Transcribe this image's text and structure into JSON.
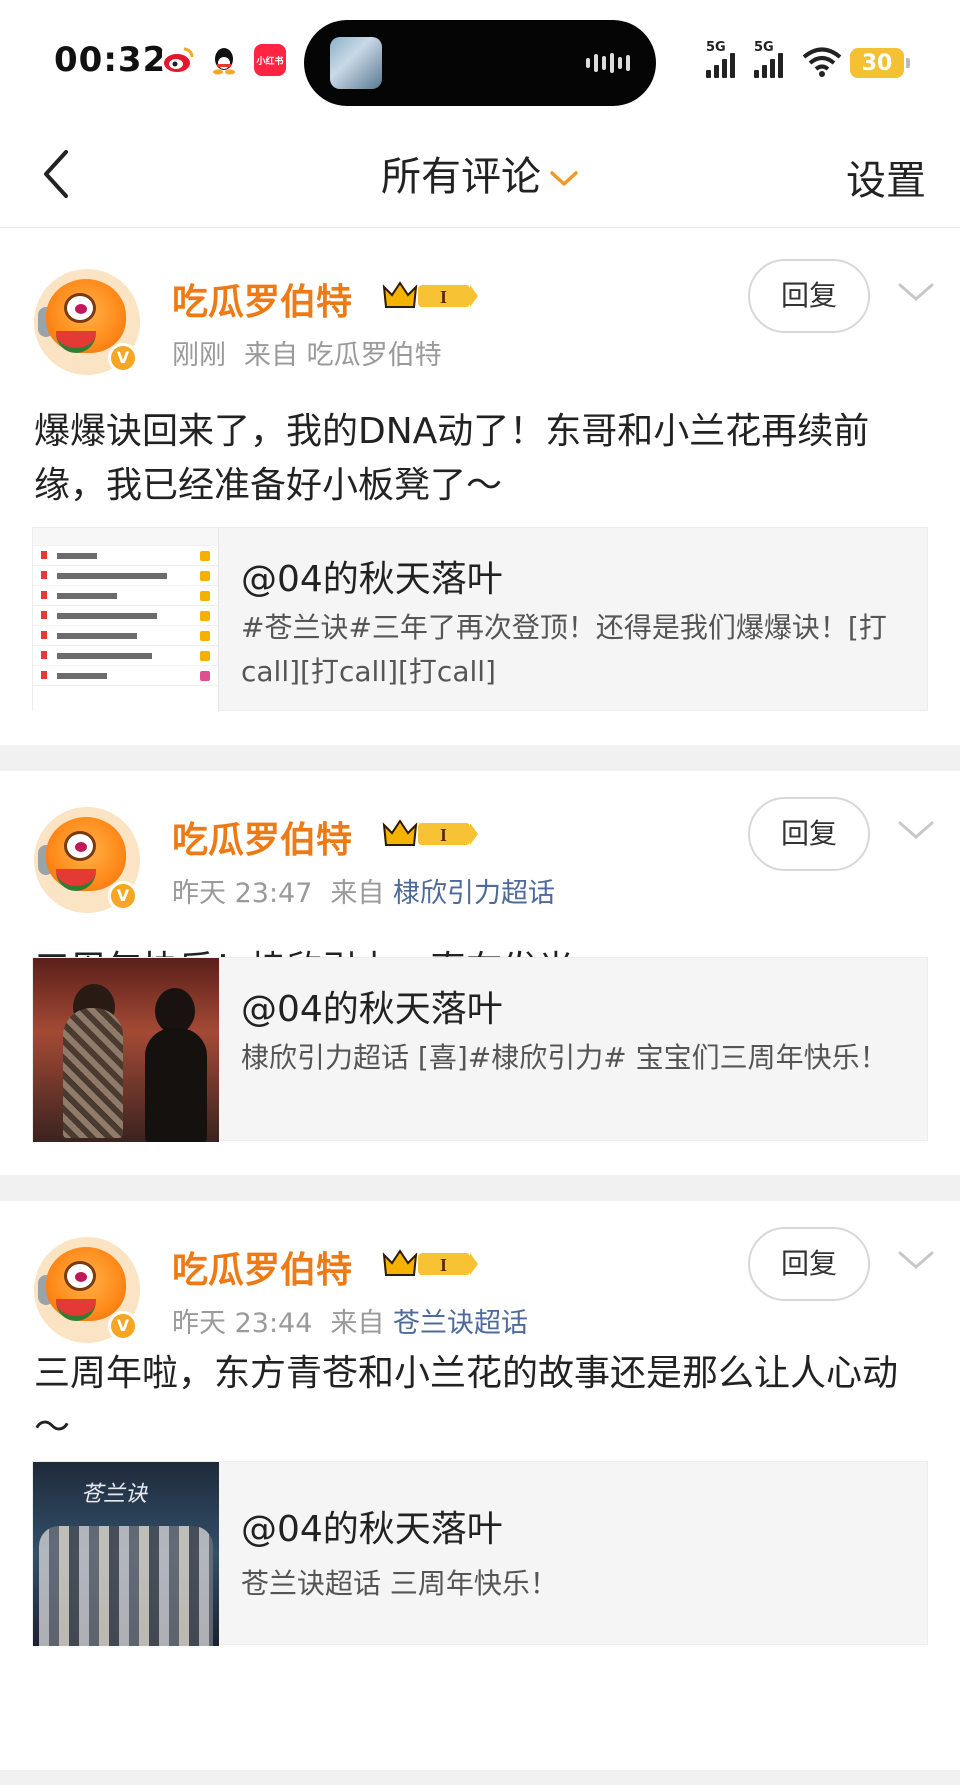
{
  "status_bar": {
    "time": "00:32",
    "apps": [
      "weibo-icon",
      "qq-icon",
      "xiaohongshu-icon"
    ],
    "xhs_label": "小红书",
    "signal_1": "5G",
    "signal_2": "5G",
    "battery": "30",
    "battery_color": "#f3c132"
  },
  "nav": {
    "title": "所有评论",
    "settings_label": "设置",
    "accent": "#ee7a16"
  },
  "comments": [
    {
      "username": "吃瓜罗伯特",
      "time": "刚刚",
      "source_prefix": "来自",
      "source": "吃瓜罗伯特",
      "reply_label": "回复",
      "text": "爆爆诀回来了，我的DNA动了！东哥和小兰花再续前缘，我已经准备好小板凳了～",
      "quote": {
        "title": "@04的秋天落叶",
        "text": "#苍兰诀#三年了再次登顶！还得是我们爆爆诀！[打call][打call][打call]"
      }
    },
    {
      "username": "吃瓜罗伯特",
      "time": "昨天 23:47",
      "source_prefix": "来自",
      "source": "棣欣引力超话",
      "reply_label": "回复",
      "text": "三周年快乐！棣欣引力一直在发光～",
      "quote": {
        "title": "@04的秋天落叶",
        "text": "棣欣引力超话 [喜]#棣欣引力# 宝宝们三周年快乐！"
      }
    },
    {
      "username": "吃瓜罗伯特",
      "time": "昨天 23:44",
      "source_prefix": "来自",
      "source": "苍兰诀超话",
      "reply_label": "回复",
      "text": "三周年啦，东方青苍和小兰花的故事还是那么让人心动～",
      "quote": {
        "title": "@04的秋天落叶",
        "text": "苍兰诀超话 三周年快乐！",
        "image_title": "苍兰诀"
      }
    }
  ]
}
